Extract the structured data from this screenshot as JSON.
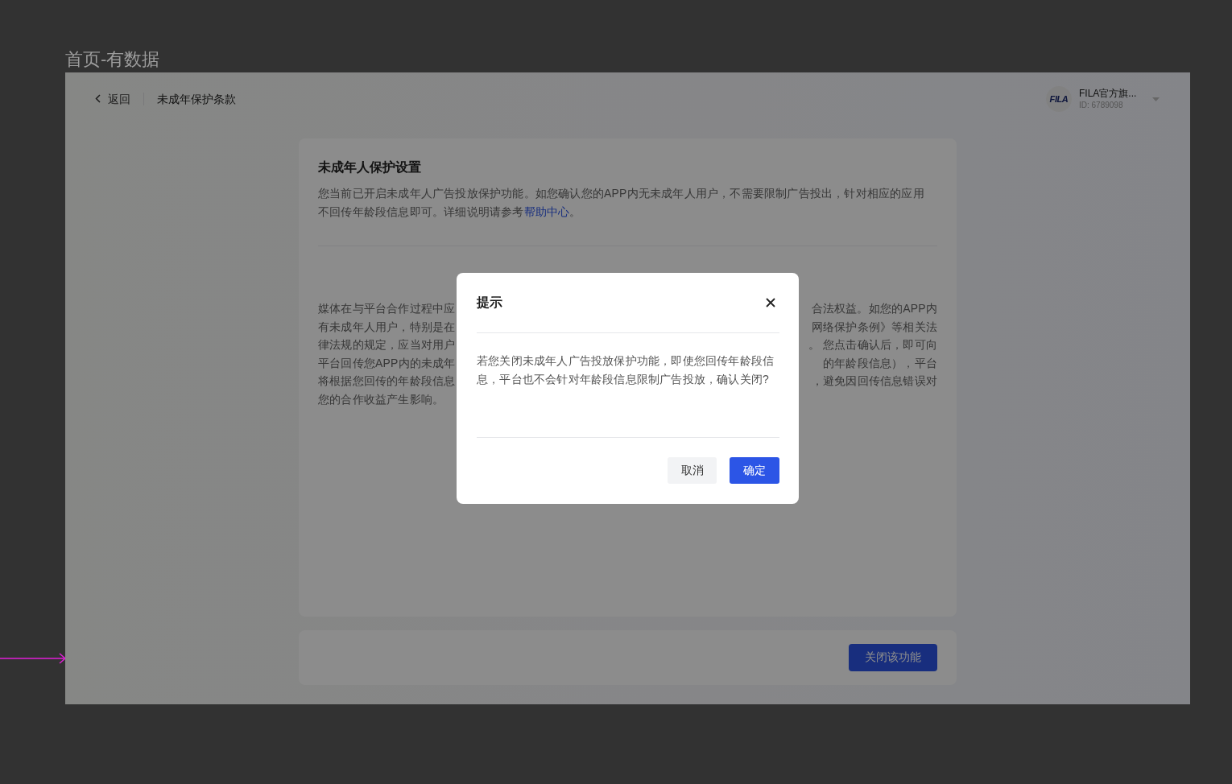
{
  "canvas": {
    "frame_title": "首页-有数据"
  },
  "header": {
    "back_label": "返回",
    "page_title": "未成年保护条款",
    "account": {
      "logo_text": "FILA",
      "name": "FILA官方旗...",
      "id": "ID: 6789098"
    }
  },
  "settings_card": {
    "title": "未成年人保护设置",
    "description": {
      "text": "您当前已开启未成年人广告投放保护功能。如您确认您的APP内无未成年人用户，不需要限制广告投出，针对相应的应用不回传年龄段信息即可。详细说明请参考",
      "link": "帮助中心",
      "after": "。"
    },
    "body_lines": [
      {
        "left": "媒体在与平台合作过程中应",
        "right": "合法权益。如您的APP内"
      },
      {
        "left": "有未成年人用户，特别是在",
        "right": "网络保护条例》等相关法"
      },
      {
        "left": "律法规的规定，应当对用户",
        "right": "。 您点击确认后，即可向"
      },
      {
        "left": "平台回传您APP内的未成年",
        "right": "的年龄段信息），平台"
      },
      {
        "left": "将根据您回传的年龄段信息",
        "right": "，避免因回传信息错误对"
      },
      {
        "left": "您的合作收益产生影响。"
      }
    ]
  },
  "footer": {
    "button": "关闭该功能"
  },
  "dialog": {
    "title": "提示",
    "message": "若您关闭未成年人广告投放保护功能，即使您回传年龄段信息，平台也不会针对年龄段信息限制广告投放，确认关闭?",
    "buttons": [
      {
        "label": "取消",
        "kind": "secondary"
      },
      {
        "label": "确定",
        "kind": "primary"
      }
    ]
  }
}
